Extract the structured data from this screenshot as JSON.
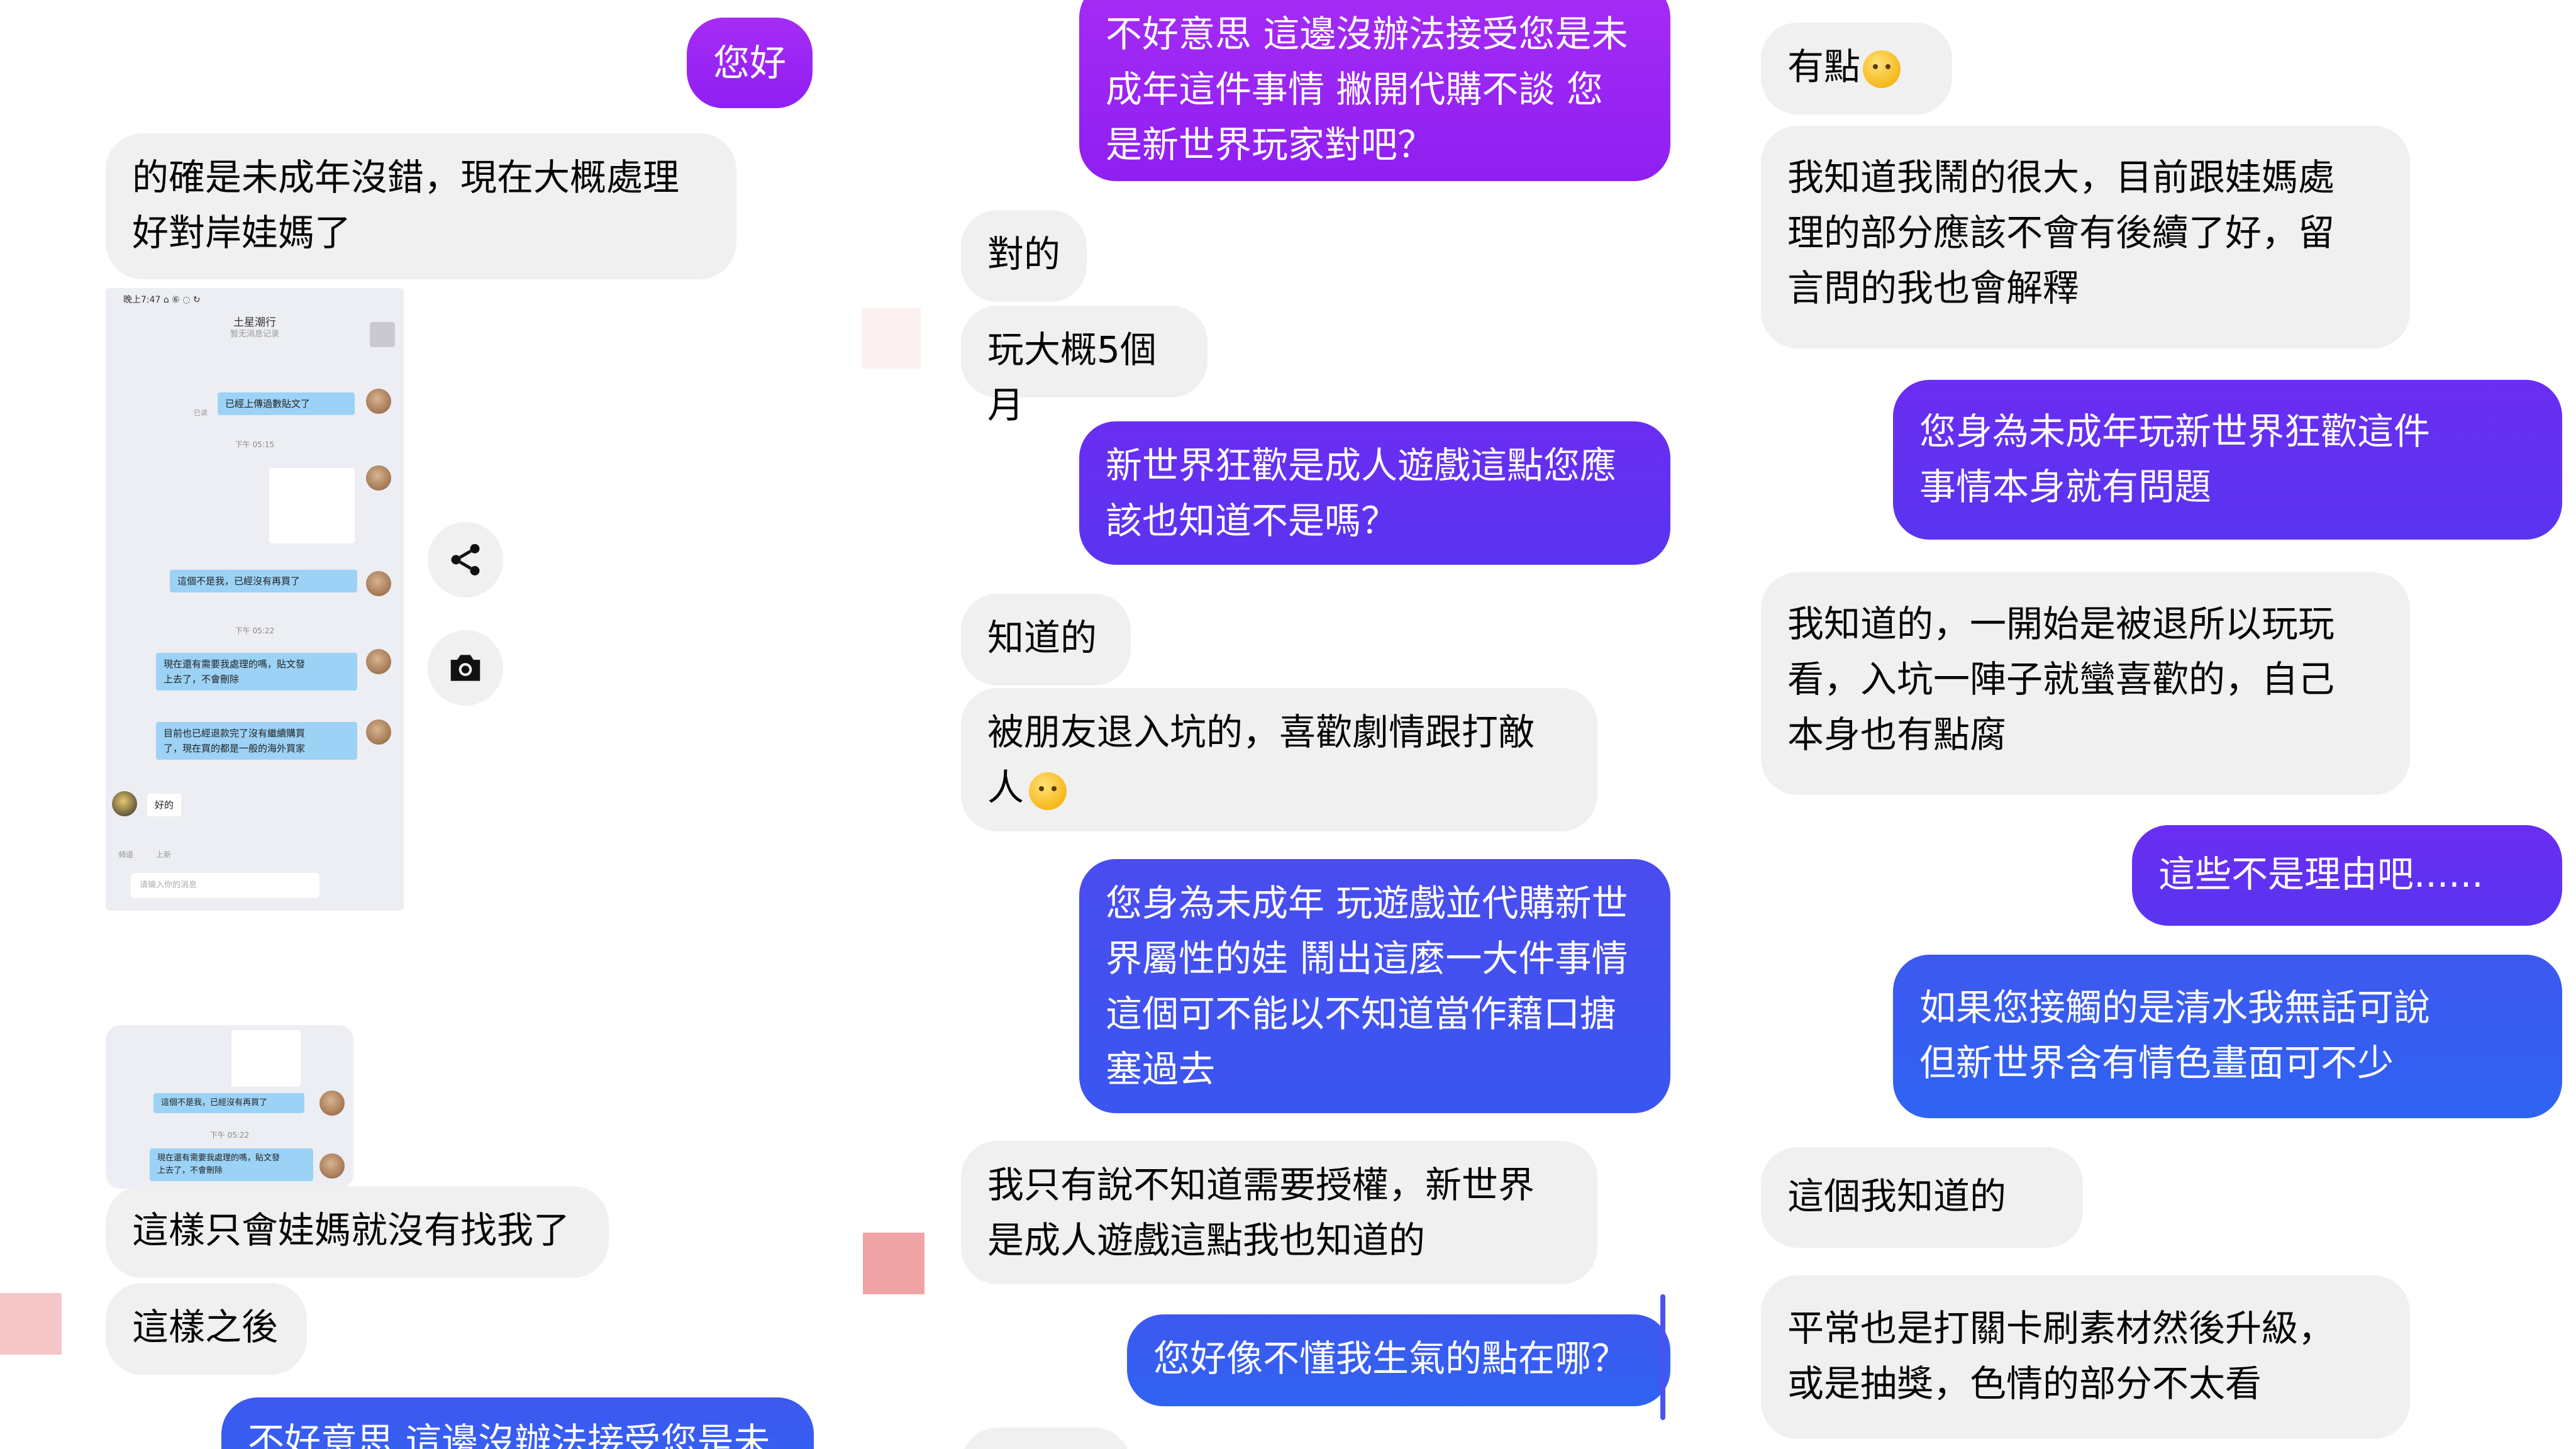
{
  "left": {
    "msg_hello": "您好",
    "msg_1": "的確是未成年沒錯，現在大概處理\n好對岸娃媽了",
    "phone": {
      "status": "晚上7:47 ⌂ ⑥ ◌ ↻",
      "title": "土星潮行",
      "subtitle": "暂无消息记录",
      "b1": "已經上傳過數貼文了",
      "b2": "這個不是我，已經沒有再買了",
      "b3": "現在還有需要我處理的嗎，貼文發\n上去了，不會刪除",
      "b4": "目前也已經退款完了沒有繼續購買\n了，現在買的都是一般的海外買家",
      "b5": "好的",
      "time1": "下午 05:15",
      "time2": "下午 05:22",
      "read": "已读",
      "quick1": "頻道",
      "quick2": "上新",
      "input": "请输入你的消息"
    },
    "thumb": {
      "b1": "這個不是我，已經沒有再買了",
      "b2": "現在還有需要我處理的嗎，貼文發\n上去了，不會刪除",
      "time": "下午 05:22"
    },
    "msg_2": "這樣只會娃媽就沒有找我了",
    "msg_3": "這樣之後",
    "msg_4": "不好意思 這邊沒辦法接受您是未"
  },
  "middle": {
    "msg_1": "不好意思 這邊沒辦法接受您是未\n成年這件事情 撇開代購不談 您\n是新世界玩家對吧？",
    "msg_2": "對的",
    "msg_3": "玩大概5個月",
    "msg_4": "新世界狂歡是成人遊戲這點您應\n該也知道不是嗎？",
    "msg_5": "知道的",
    "msg_6": "被朋友退入坑的，喜歡劇情跟打敵\n人",
    "msg_7": "您身為未成年 玩遊戲並代購新世\n界屬性的娃 鬧出這麼一大件事情\n這個可不能以不知道當作藉口搪\n塞過去",
    "msg_8": "我只有說不知道需要授權，新世界\n是成人遊戲這點我也知道的",
    "msg_9": "您好像不懂我生氣的點在哪？"
  },
  "right": {
    "msg_1": "有點",
    "msg_2": "我知道我鬧的很大，目前跟娃媽處\n理的部分應該不會有後續了好，留\n言問的我也會解釋",
    "msg_3": "您身為未成年玩新世界狂歡這件\n事情本身就有問題",
    "msg_4": "我知道的，一開始是被退所以玩玩\n看，入坑一陣子就蠻喜歡的，自己\n本身也有點腐",
    "msg_5": "這些不是理由吧......",
    "msg_6": "如果您接觸的是清水我無話可說\n但新世界含有情色畫面可不少",
    "msg_7": "這個我知道的",
    "msg_8": "平常也是打關卡刷素材然後升級，\n或是抽獎，色情的部分不太看"
  },
  "colors": {
    "incoming": "#f0f0f0",
    "outgoing_violet": "#9b24f3",
    "outgoing_purple": "#632ff1",
    "outgoing_blue": "#3560f1"
  },
  "icons": [
    "share-icon",
    "camera-icon",
    "sad-face-emoji",
    "thinking-face-emoji"
  ]
}
